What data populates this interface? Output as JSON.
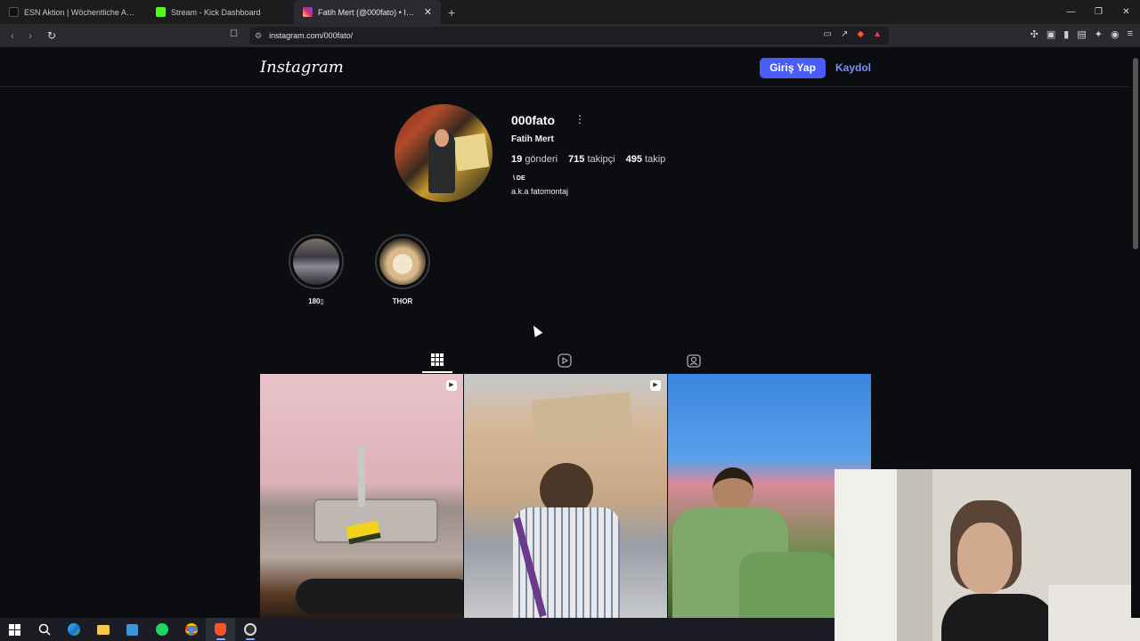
{
  "browser": {
    "tabs": [
      {
        "title": "ESN Aktion | Wöchentliche Aktionen",
        "favicon_color": "#222222",
        "active": false
      },
      {
        "title": "Stream - Kick Dashboard",
        "favicon_color": "#53fc18",
        "active": false
      },
      {
        "title": "Fatih Mert (@000fato) • Instagram",
        "favicon_color": "#e1306c",
        "active": true
      }
    ],
    "new_tab_label": "+",
    "url": "instagram.com/000fato/"
  },
  "instagram": {
    "logo": "Instagram",
    "login_label": "Giriş Yap",
    "signup_label": "Kaydol",
    "profile": {
      "username": "000fato",
      "full_name": "Fatih Mert",
      "posts_count": "19",
      "posts_label": "gönderi",
      "followers_count": "715",
      "followers_label": "takipçi",
      "following_count": "495",
      "following_label": "takip",
      "bio_line1": "\\ DE",
      "bio_line2": "a.k.a fatomontaj"
    },
    "highlights": [
      {
        "label": "180▯"
      },
      {
        "label": "THOR"
      }
    ],
    "profile_tabs": [
      "grid-icon",
      "reels-icon",
      "tagged-icon"
    ],
    "posts": [
      {
        "subject": "kitchen sink with sponge",
        "type": "reel"
      },
      {
        "subject": "person holding a protest sign",
        "type": "reel"
      },
      {
        "subject": "two people in green jackets",
        "type": "photo"
      }
    ]
  },
  "taskbar": {
    "items": [
      "windows-start-icon",
      "search-icon",
      "edge-icon",
      "file-explorer-icon",
      "app-icon",
      "spotify-icon",
      "chrome-icon",
      "brave-icon",
      "obs-icon"
    ]
  }
}
